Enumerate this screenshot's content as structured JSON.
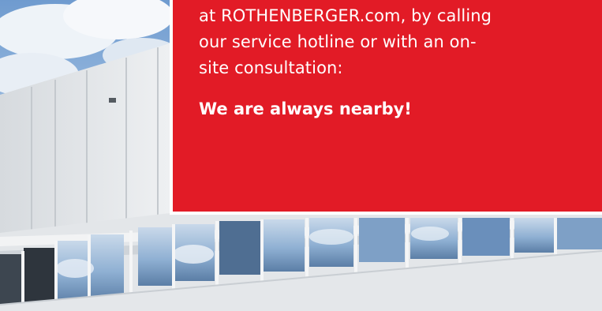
{
  "panel": {
    "body_lines": [
      "at ROTHENBERGER.com, by calling",
      "our service hotline or with an on-",
      "site consultation:"
    ],
    "tagline": "We are always nearby!"
  },
  "colors": {
    "panel_red": "#e21b26",
    "text": "#ffffff",
    "sky": "#8fb3d9",
    "facade": "#e6e8ea"
  },
  "icons": {
    "photo": "building-facade-photo"
  }
}
